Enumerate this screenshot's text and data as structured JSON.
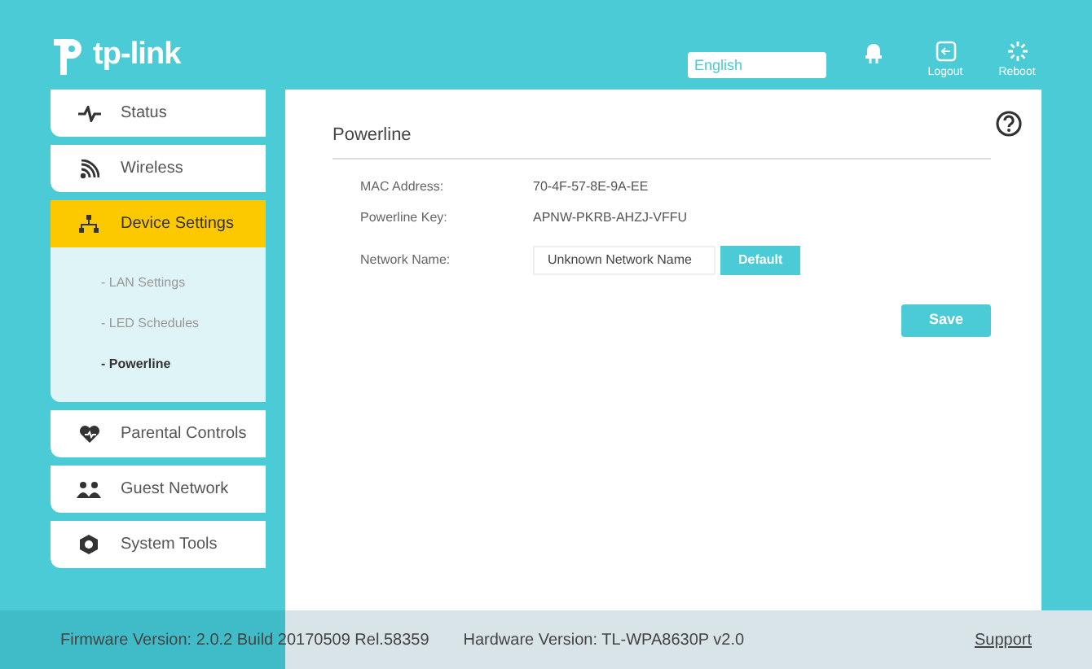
{
  "header": {
    "logo": "tp-link",
    "language": {
      "value": "English"
    },
    "actions": [
      {
        "kind": "led"
      },
      {
        "kind": "logout",
        "label": "Logout"
      },
      {
        "kind": "reboot",
        "label": "Reboot"
      }
    ]
  },
  "sidebar": {
    "items": [
      {
        "kind": "pulse",
        "label": "Status",
        "selected": false
      },
      {
        "kind": "wifi",
        "label": "Wireless",
        "selected": false
      },
      {
        "kind": "network",
        "label": "Device Settings",
        "selected": true,
        "children": [
          {
            "label": "- LAN Settings",
            "selected": false
          },
          {
            "label": "- LED Schedules",
            "selected": false
          },
          {
            "label": "- Powerline",
            "selected": true
          }
        ]
      },
      {
        "kind": "heart",
        "label": "Parental Controls",
        "selected": false
      },
      {
        "kind": "guests",
        "label": "Guest Network",
        "selected": false
      },
      {
        "kind": "gear",
        "label": "System Tools",
        "selected": false
      }
    ]
  },
  "main": {
    "title": "Powerline",
    "fields": [
      {
        "kind": "text",
        "label": "MAC Address:",
        "value": "70-4F-57-8E-9A-EE"
      },
      {
        "kind": "text",
        "label": "Powerline Key:",
        "value": "APNW-PKRB-AHZJ-VFFU"
      },
      {
        "kind": "input",
        "label": "Network Name:",
        "value": "Unknown Network Name",
        "button": "Default"
      }
    ],
    "save": "Save"
  },
  "footer": {
    "firmware": "Firmware Version: 2.0.2 Build 20170509 Rel.58359",
    "hardware": "Hardware Version: TL-WPA8630P v2.0",
    "support": "Support"
  }
}
